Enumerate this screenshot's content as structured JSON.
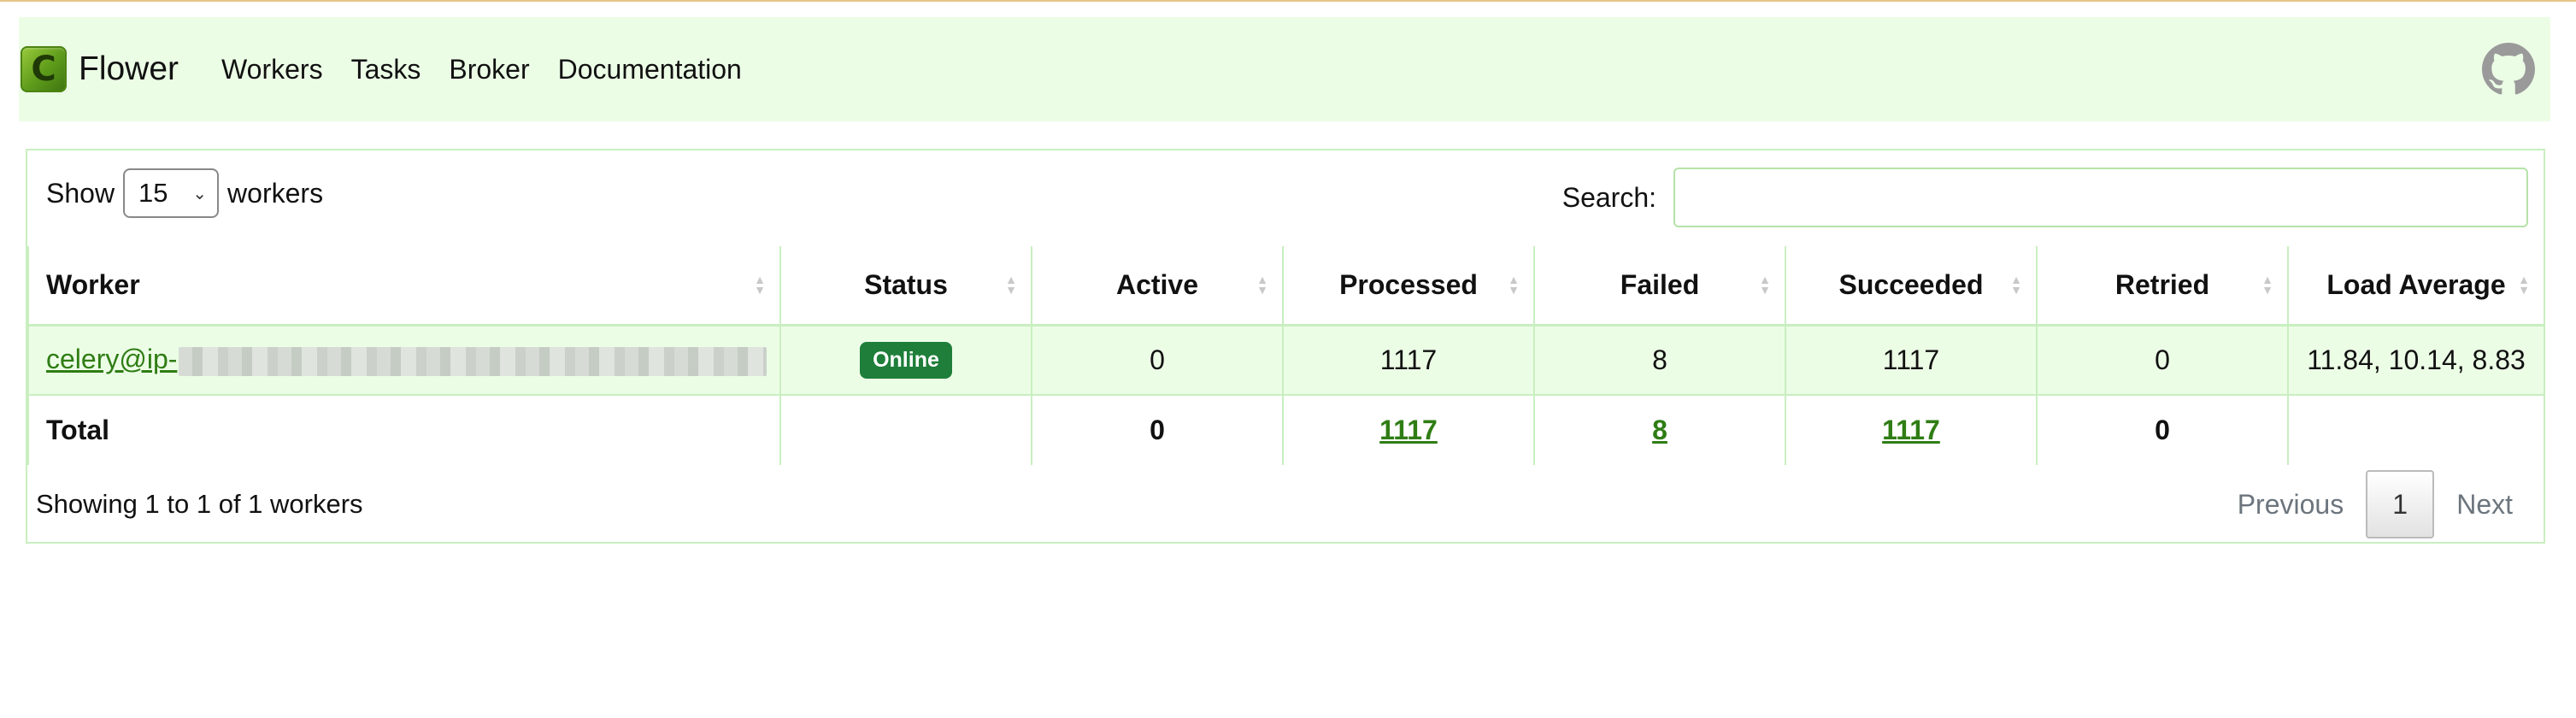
{
  "navbar": {
    "brand_logo_letter": "C",
    "brand_name": "Flower",
    "links": [
      "Workers",
      "Tasks",
      "Broker",
      "Documentation"
    ],
    "github_icon": "github-icon"
  },
  "controls": {
    "show_label": "Show",
    "page_size": "15",
    "workers_label": "workers",
    "search_label": "Search:",
    "search_value": ""
  },
  "table": {
    "columns": [
      "Worker",
      "Status",
      "Active",
      "Processed",
      "Failed",
      "Succeeded",
      "Retried",
      "Load Average"
    ],
    "rows": [
      {
        "worker": "celery@ip-",
        "status": "Online",
        "active": "0",
        "processed": "1117",
        "failed": "8",
        "succeeded": "1117",
        "retried": "0",
        "load_average": "11.84, 10.14, 8.83"
      }
    ],
    "total": {
      "label": "Total",
      "active": "0",
      "processed": "1117",
      "failed": "8",
      "succeeded": "1117",
      "retried": "0"
    }
  },
  "footer": {
    "info": "Showing 1 to 1 of 1 workers",
    "previous": "Previous",
    "page": "1",
    "next": "Next"
  },
  "colors": {
    "navbar_bg": "#ecfde6",
    "border": "#c9efc0",
    "link": "#2f7d14",
    "status_online": "#1e7e3a"
  }
}
